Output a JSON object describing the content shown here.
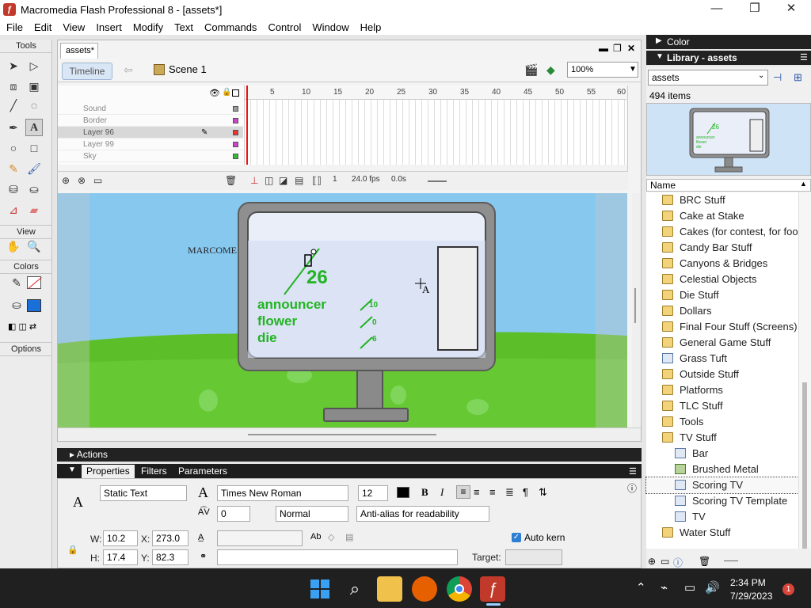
{
  "window": {
    "title": "Macromedia Flash Professional 8 - [assets*]",
    "controls": [
      "—",
      "❐",
      "✕"
    ]
  },
  "menu": [
    "File",
    "Edit",
    "View",
    "Insert",
    "Modify",
    "Text",
    "Commands",
    "Control",
    "Window",
    "Help"
  ],
  "tools": {
    "header": "Tools",
    "view_label": "View",
    "colors_label": "Colors",
    "options_label": "Options"
  },
  "document": {
    "tab": "assets*",
    "timeline_button": "Timeline",
    "scene": "Scene 1",
    "zoom": "100%"
  },
  "timeline": {
    "ruler": [
      "5",
      "10",
      "15",
      "20",
      "25",
      "30",
      "35",
      "40",
      "45",
      "50",
      "55",
      "60"
    ],
    "layers": [
      "Sound",
      "Border",
      "Layer 96",
      "Layer 99",
      "Sky"
    ],
    "selected_layer": "Layer 96",
    "current_frame": "1",
    "fps": "24.0 fps",
    "time": "0.0s"
  },
  "stage": {
    "marcom_text": "MARCOME",
    "big_number": "26",
    "labels": [
      "announcer",
      "flower",
      "die"
    ],
    "small_numbers": [
      "10",
      "0",
      "6"
    ],
    "cursor_letter": "A"
  },
  "panels": {
    "actions": "Actions",
    "props_tabs": [
      "Properties",
      "Filters",
      "Parameters"
    ]
  },
  "properties": {
    "text_type": "Static Text",
    "font": "Times New Roman",
    "size": "12",
    "letter_spacing": "0",
    "position_mode": "Normal",
    "anti_alias": "Anti-alias for readability",
    "auto_kern": "Auto kern",
    "W_label": "W:",
    "W": "10.2",
    "H_label": "H:",
    "H": "17.4",
    "X_label": "X:",
    "X": "273.0",
    "Y_label": "Y:",
    "Y": "82.3",
    "target_label": "Target:"
  },
  "library": {
    "color_title": "Color",
    "title": "Library - assets",
    "selected_library": "assets",
    "count": "494 items",
    "name_header": "Name",
    "items": [
      {
        "name": "BRC Stuff",
        "type": "folder",
        "indent": 0
      },
      {
        "name": "Cake at Stake",
        "type": "folder",
        "indent": 0
      },
      {
        "name": "Cakes (for contest, for food",
        "type": "folder",
        "indent": 0
      },
      {
        "name": "Candy Bar Stuff",
        "type": "folder",
        "indent": 0
      },
      {
        "name": "Canyons & Bridges",
        "type": "folder",
        "indent": 0
      },
      {
        "name": "Celestial Objects",
        "type": "folder",
        "indent": 0
      },
      {
        "name": "Die Stuff",
        "type": "folder",
        "indent": 0
      },
      {
        "name": "Dollars",
        "type": "folder",
        "indent": 0
      },
      {
        "name": "Final Four Stuff (Screens)",
        "type": "folder",
        "indent": 0
      },
      {
        "name": "General Game Stuff",
        "type": "folder",
        "indent": 0
      },
      {
        "name": "Grass Tuft",
        "type": "symbol",
        "indent": 0
      },
      {
        "name": "Outside Stuff",
        "type": "folder",
        "indent": 0
      },
      {
        "name": "Platforms",
        "type": "folder",
        "indent": 0
      },
      {
        "name": "TLC Stuff",
        "type": "folder",
        "indent": 0
      },
      {
        "name": "Tools",
        "type": "folder",
        "indent": 0
      },
      {
        "name": "TV Stuff",
        "type": "folder-open",
        "indent": 0
      },
      {
        "name": "Bar",
        "type": "symbol",
        "indent": 1
      },
      {
        "name": "Brushed Metal",
        "type": "bitmap",
        "indent": 1
      },
      {
        "name": "Scoring TV",
        "type": "symbol",
        "indent": 1,
        "selected": true
      },
      {
        "name": "Scoring TV Template",
        "type": "symbol",
        "indent": 1
      },
      {
        "name": "TV",
        "type": "symbol",
        "indent": 1
      },
      {
        "name": "Water Stuff",
        "type": "folder",
        "indent": 0
      }
    ]
  },
  "taskbar": {
    "time": "2:34 PM",
    "date": "7/29/2023",
    "notification_count": "1"
  },
  "colors": {
    "stage_sky": "#87c8ef",
    "grass": "#5cbf2a",
    "accent_green": "#22b422",
    "taskbar": "#202020"
  }
}
